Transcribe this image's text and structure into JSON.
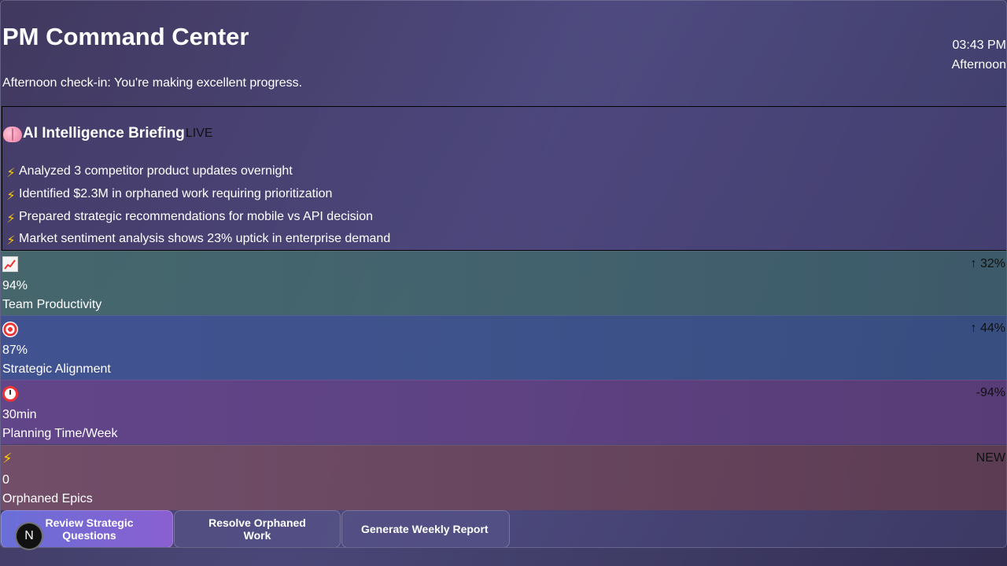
{
  "header": {
    "title": "PM Command Center",
    "subtitle": "Afternoon check-in: You're making excellent progress.",
    "time": "03:43 PM",
    "period": "Afternoon"
  },
  "briefing": {
    "icon": "brain-icon",
    "title": "AI Intelligence Briefing",
    "status": "LIVE",
    "items": [
      {
        "icon": "lightning-icon",
        "text": "Analyzed 3 competitor product updates overnight"
      },
      {
        "icon": "lightning-icon",
        "text": "Identified $2.3M in orphaned work requiring prioritization"
      },
      {
        "icon": "lightning-icon",
        "text": "Prepared strategic recommendations for mobile vs API decision"
      },
      {
        "icon": "lightning-icon",
        "text": "Market sentiment analysis shows 23% uptick in enterprise demand"
      }
    ]
  },
  "metrics": [
    {
      "icon": "chart-increasing-icon",
      "value": "94%",
      "label": "Team Productivity",
      "change": "↑ 32%",
      "color": "#46706e"
    },
    {
      "icon": "target-icon",
      "value": "87%",
      "label": "Strategic Alignment",
      "change": "↑ 44%",
      "color": "#415596"
    },
    {
      "icon": "alarm-clock-icon",
      "value": "30min",
      "label": "Planning Time/Week",
      "change": "-94%",
      "color": "#64468c"
    },
    {
      "icon": "lightning-icon",
      "value": "0",
      "label": "Orphaned Epics",
      "change": "NEW",
      "color": "#785069"
    }
  ],
  "actions": {
    "primary": "Review Strategic Questions",
    "secondary": "Resolve Orphaned Work",
    "tertiary": "Generate Weekly Report"
  },
  "badge": {
    "letter": "N"
  }
}
